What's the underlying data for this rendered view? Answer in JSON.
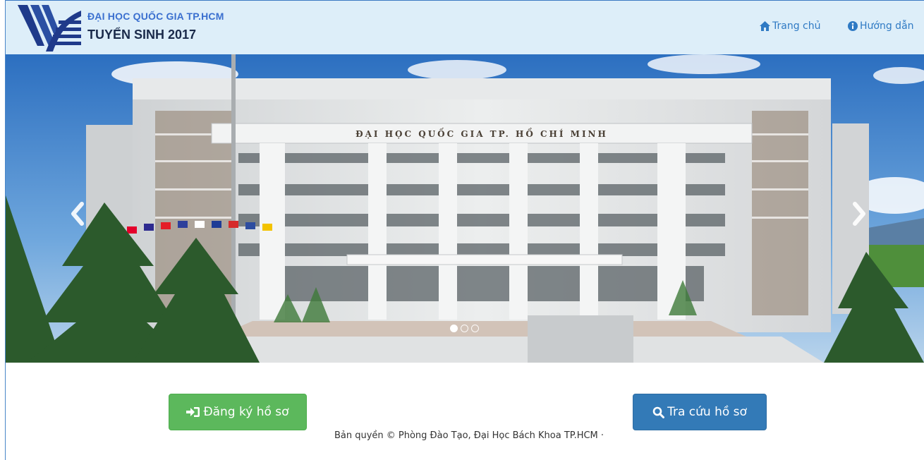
{
  "header": {
    "brand_top": "ĐẠI HỌC QUỐC GIA TP.HCM",
    "brand_bottom": "TUYỂN SINH 2017",
    "nav": [
      {
        "label": "Trang chủ",
        "icon": "home-icon"
      },
      {
        "label": "Hướng dẫn",
        "icon": "info-circle-icon"
      }
    ]
  },
  "hero": {
    "building_sign": "ĐẠI HỌC QUỐC GIA TP. HỒ CHÍ MINH",
    "prev_icon": "chevron-left-icon",
    "next_icon": "chevron-right-icon",
    "indicators": [
      {
        "active": true
      },
      {
        "active": false
      },
      {
        "active": false
      }
    ]
  },
  "actions": {
    "register_label": "Đăng ký hồ sơ",
    "register_icon": "sign-in-icon",
    "lookup_label": "Tra cứu hồ sơ",
    "lookup_icon": "search-icon"
  },
  "footer": {
    "copyright": "Bản quyền © Phòng Đào Tạo, Đại Học Bách Khoa TP.HCM ·"
  },
  "colors": {
    "header_bg": "#ddeef9",
    "link": "#2f7ac4",
    "brand_top": "#3a6fcf",
    "success": "#5cb85c",
    "primary": "#337ab7"
  }
}
